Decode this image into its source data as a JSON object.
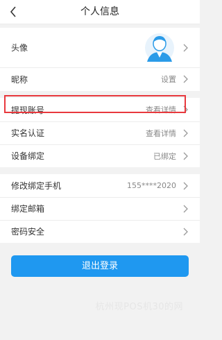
{
  "header": {
    "title": "个人信息"
  },
  "group1": {
    "avatar_label": "头像",
    "nickname_label": "昵称",
    "nickname_value": "设置"
  },
  "group2": {
    "withdraw_label": "提现账号",
    "withdraw_value": "查看详情",
    "realname_label": "实名认证",
    "realname_value": "查看详情",
    "device_label": "设备绑定",
    "device_value": "已绑定"
  },
  "group3": {
    "phone_label": "修改绑定手机",
    "phone_value": "155****2020",
    "email_label": "绑定邮箱",
    "password_label": "密码安全"
  },
  "logout_label": "退出登录",
  "watermark": "杭州现POS机30的网",
  "colors": {
    "accent": "#1f98f0",
    "highlight": "#e8383d"
  }
}
